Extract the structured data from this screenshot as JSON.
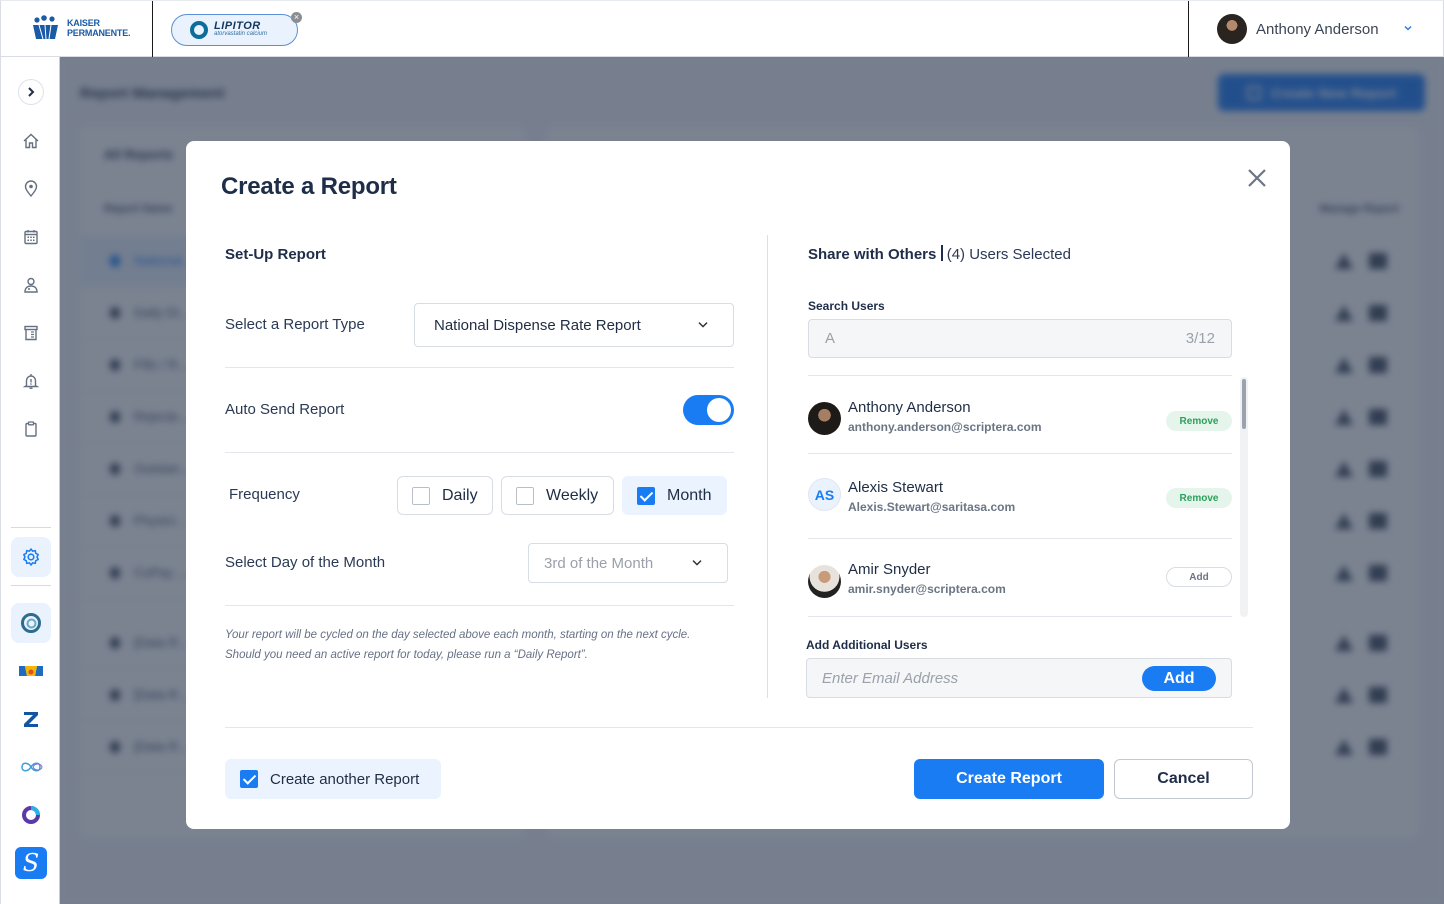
{
  "header": {
    "org_logo": {
      "line1": "KAISER",
      "line2": "PERMANENTE."
    },
    "brand_chip": {
      "name": "LIPITOR",
      "subtitle": "atorvastatin calcium",
      "close": "×"
    },
    "user": {
      "name": "Anthony Anderson"
    }
  },
  "sidebar": {
    "toggle": "›",
    "nav_icons": [
      "home-icon",
      "location-pin-icon",
      "calendar-icon",
      "doctor-icon",
      "archive-icon",
      "alert-bell-icon",
      "clipboard-icon"
    ],
    "active": "settings-icon",
    "apps": [
      "lipitor-app",
      "crown-app",
      "z-app",
      "infinity-app",
      "circle-app",
      "s-app"
    ],
    "s_app_letter": "S"
  },
  "background": {
    "page_title": "Report Management",
    "create_button": "Create New Report",
    "panel_title": "All Reports",
    "col_report_name": "Report Name",
    "col_manage": "Manage Report",
    "rows": [
      "National...",
      "Daily Di...",
      "Fills / R...",
      "Rejecte...",
      "Outstan...",
      "Physici...",
      "CoPay ... Authori...",
      "[Data R...",
      "[Data R...",
      "[Data R..."
    ]
  },
  "modal": {
    "title": "Create a Report",
    "setup": {
      "section_title": "Set-Up Report",
      "report_type_label": "Select a Report Type",
      "report_type_value": "National Dispense Rate Report",
      "auto_send_label": "Auto Send Report",
      "auto_send_on": true,
      "frequency_label": "Frequency",
      "frequency_options": [
        {
          "label": "Daily",
          "checked": false
        },
        {
          "label": "Weekly",
          "checked": false
        },
        {
          "label": "Month",
          "checked": true
        }
      ],
      "day_label": "Select Day of the Month",
      "day_value": "3rd of the Month",
      "note": "Your report will be cycled on the day selected above each month, starting on the next cycle. Should you need an active report for today, please run a “Daily Report”."
    },
    "share": {
      "title": "Share with Others",
      "selected": "(4) Users Selected",
      "search_label": "Search Users",
      "search_value": "A",
      "search_count": "3/12",
      "users": [
        {
          "name": "Anthony Anderson",
          "email": "anthony.anderson@scriptera.com",
          "action": "Remove",
          "initials": ""
        },
        {
          "name": "Alexis Stewart",
          "email": "Alexis.Stewart@saritasa.com",
          "action": "Remove",
          "initials": "AS"
        },
        {
          "name": "Amir Snyder",
          "email": "amir.snyder@scriptera.com",
          "action": "Add",
          "initials": ""
        }
      ],
      "add_label": "Add Additional Users",
      "email_placeholder": "Enter Email Address",
      "add_button": "Add"
    },
    "footer": {
      "create_another": "Create another Report",
      "create_another_checked": true,
      "create_button": "Create Report",
      "cancel_button": "Cancel"
    }
  }
}
